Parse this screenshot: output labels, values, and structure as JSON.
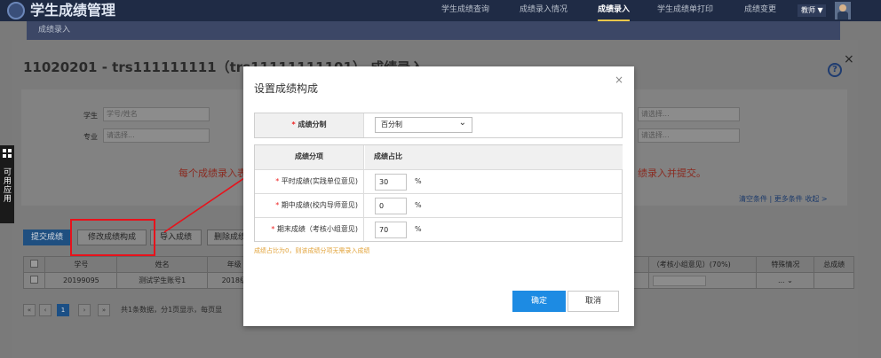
{
  "app": {
    "title": "学生成绩管理"
  },
  "nav": [
    "学生成绩查询",
    "成绩录入情况",
    "成绩录入",
    "学生成绩单打印",
    "成绩变更"
  ],
  "role": "教师 ▼",
  "breadcrumb": "成绩录入",
  "page": {
    "title": "11020201 - trs111111111（trs11111111101） 成绩录入",
    "help": "?",
    "close": "×"
  },
  "filters": {
    "student_label": "学生",
    "student_placeholder": "学号/姓名",
    "major_label": "专业",
    "major_value": "请选择...",
    "select_a": "请选择...",
    "select_b": "请选择..."
  },
  "warning_left": "每个成绩录入表",
  "warning_right": "绩录入并提交。",
  "filter_links": "清空条件 | 更多条件   收起 >",
  "side_tab": "可用应用",
  "buttons": {
    "submit": "提交成绩",
    "modify": "修改成绩构成",
    "import": "导入成绩",
    "delete": "删除成绩"
  },
  "table": {
    "headers": [
      "学号",
      "姓名",
      "年级",
      "（考核小组意见）(70%)",
      "特殊情况",
      "总成绩"
    ],
    "rows": [
      [
        "20199095",
        "测试学生账号1",
        "2018级",
        "",
        "...",
        ""
      ]
    ]
  },
  "pager": {
    "first": "«",
    "prev": "‹",
    "current": "1",
    "next": "›",
    "last": "»",
    "info": "共1条数据，分1页显示，每页显"
  },
  "modal": {
    "title": "设置成绩构成",
    "close": "×",
    "system_label": "成绩分制",
    "system_value": "百分制",
    "col_item": "成绩分项",
    "col_ratio": "成绩占比",
    "items": [
      {
        "label": "平时成绩(实践单位意见)",
        "value": "30",
        "unit": "%"
      },
      {
        "label": "期中成绩(校内导师意见)",
        "value": "0",
        "unit": "%"
      },
      {
        "label": "期末成绩（考核小组意见)",
        "value": "70",
        "unit": "%"
      }
    ],
    "note": "成绩占比为0，则该成绩分项无需录入成绩",
    "ok": "确定",
    "cancel": "取消"
  },
  "colors": {
    "accent": "#1d8be3",
    "highlight": "#e8121b",
    "nav_bg": "#1f2b45"
  }
}
